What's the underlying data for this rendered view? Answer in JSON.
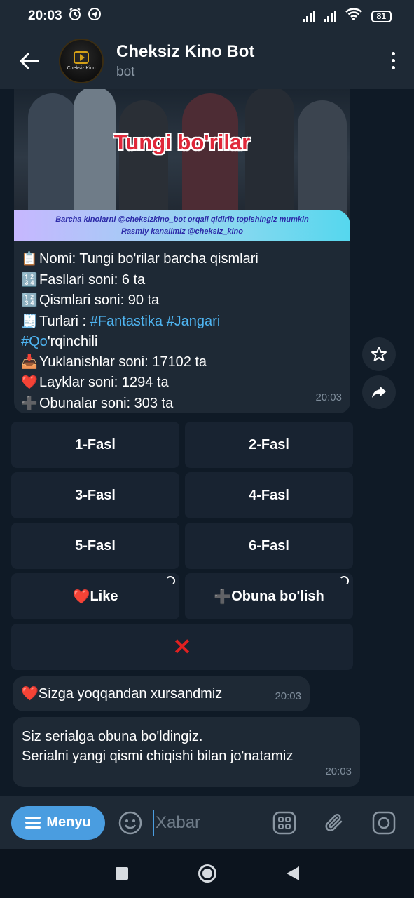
{
  "status": {
    "time": "20:03",
    "battery": "81"
  },
  "header": {
    "title": "Cheksiz Kino Bot",
    "subtitle": "bot",
    "avatar_text": "Cheksiz Kino"
  },
  "photo": {
    "title": "Tungi bo'rilar",
    "banner_line1": "Barcha kinolarni @cheksizkino_bot orqali qidirib topishingiz mumkin",
    "banner_line2": "Rasmiy kanalimiz @cheksiz_kino"
  },
  "message": {
    "name": "Nomi: Tungi bo'rilar barcha qismlari",
    "seasons": "Fasllari soni: 6 ta",
    "episodes": "Qismlari soni: 90 ta",
    "genres_prefix": "Turlari : ",
    "tag1": "#Fantastika",
    "tag2": "#Jangari",
    "tag3": "#Qo",
    "tag3_rest": "'rqinchili",
    "downloads": "Yuklanishlar soni: 17102 ta",
    "likes": "Layklar soni: 1294 ta",
    "subscribers": "Obunalar soni: 303 ta",
    "time": "20:03"
  },
  "keyboard": {
    "s1": "1-Fasl",
    "s2": "2-Fasl",
    "s3": "3-Fasl",
    "s4": "4-Fasl",
    "s5": "5-Fasl",
    "s6": "6-Fasl",
    "like": "Like",
    "subscribe": "Obuna bo'lish",
    "close": "✕"
  },
  "reply1": {
    "text": "Sizga yoqqandan xursandmiz",
    "time": "20:03"
  },
  "reply2": {
    "line1": "Siz serialga obuna bo'ldingiz.",
    "line2": "Serialni yangi qismi chiqishi bilan jo'natamiz",
    "time": "20:03"
  },
  "input": {
    "menu_label": "Menyu",
    "placeholder": "Xabar"
  },
  "icons": {
    "back": "arrow-left-icon",
    "more": "more-vert-icon",
    "star": "star-icon",
    "share": "share-icon",
    "emoji": "emoji-icon",
    "commands": "commands-icon",
    "attach": "paperclip-icon",
    "camera": "camera-icon"
  },
  "colors": {
    "accent": "#4a9de0",
    "hashtag": "#4fb5f2",
    "bubble": "#1e2935",
    "background": "#0f1a26",
    "close_red": "#e02020"
  }
}
